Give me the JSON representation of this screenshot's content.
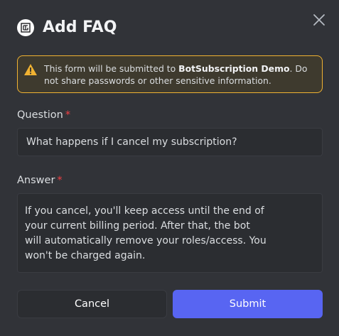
{
  "header": {
    "title": "Add FAQ",
    "logo_icon": "bot-logo-icon",
    "close_icon": "close-icon"
  },
  "warning": {
    "icon": "warning-icon",
    "text_before": "This form will be submitted to ",
    "server_name": "BotSubscription Demo",
    "text_after": ". Do not share passwords or other sensitive information."
  },
  "fields": {
    "question": {
      "label": "Question",
      "required_mark": "*",
      "value": "What happens if I cancel my subscription?"
    },
    "answer": {
      "label": "Answer",
      "required_mark": "*",
      "value": "If you cancel, you'll keep access until the end of\nyour current billing period. After that, the bot\nwill automatically remove your roles/access. You\nwon't be charged again."
    }
  },
  "buttons": {
    "cancel_label": "Cancel",
    "submit_label": "Submit"
  },
  "colors": {
    "background": "#313338",
    "input_background": "#2b2d31",
    "warning_border": "#f0b232",
    "required": "#f23f43",
    "primary": "#5865f2"
  }
}
